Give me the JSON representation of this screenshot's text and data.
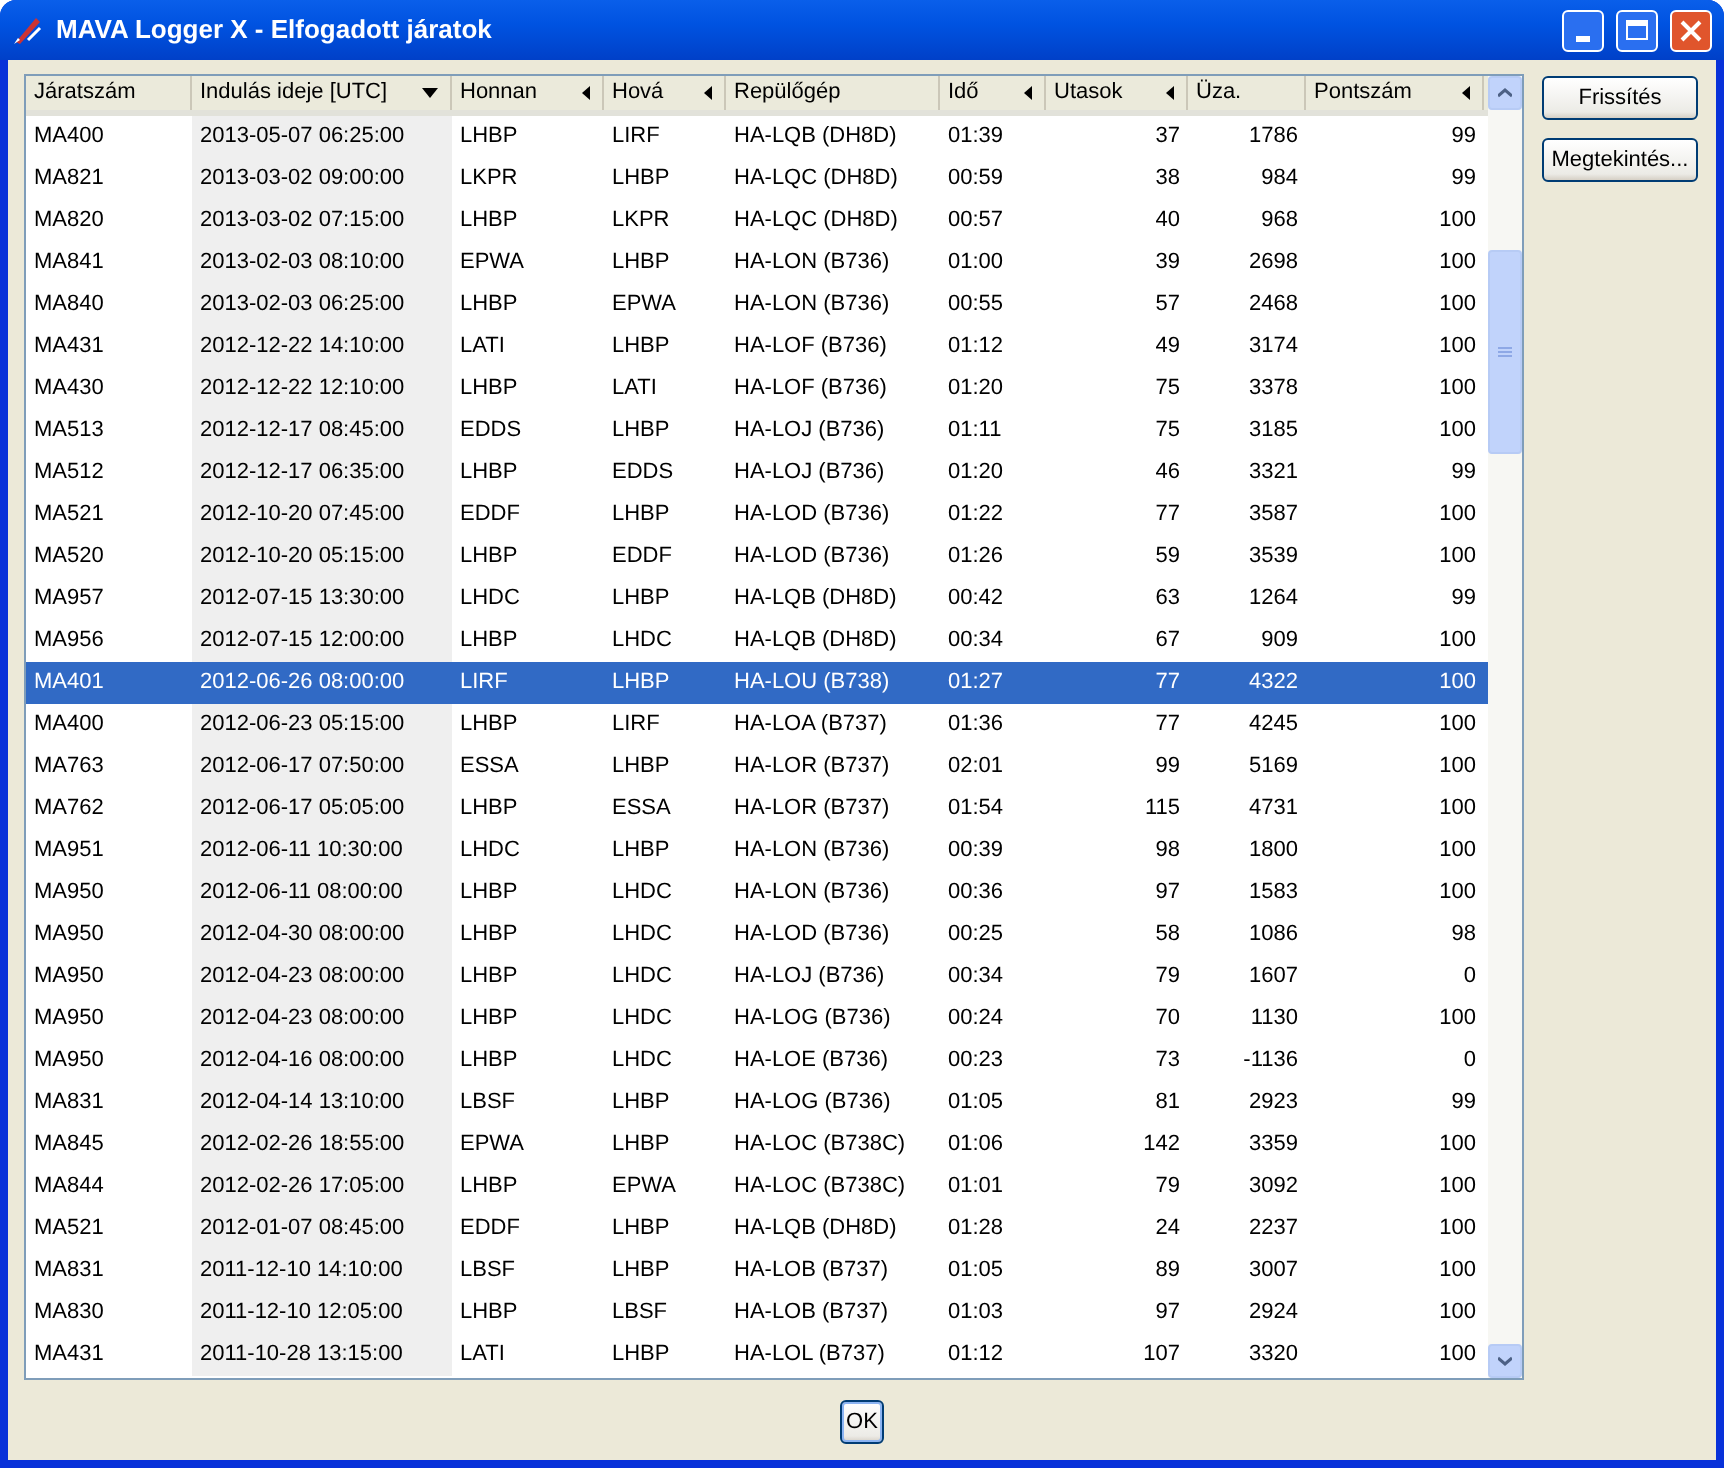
{
  "window": {
    "title": "MAVA Logger X - Elfogadott járatok"
  },
  "table": {
    "columns": [
      {
        "label": "Járatszám",
        "kind": "text",
        "sorted": false,
        "filter_arrow": false
      },
      {
        "label": "Indulás ideje [UTC]",
        "kind": "text",
        "sorted": true,
        "filter_arrow": false
      },
      {
        "label": "Honnan",
        "kind": "text",
        "sorted": false,
        "filter_arrow": true
      },
      {
        "label": "Hová",
        "kind": "text",
        "sorted": false,
        "filter_arrow": true
      },
      {
        "label": "Repülőgép",
        "kind": "text",
        "sorted": false,
        "filter_arrow": false
      },
      {
        "label": "Idő",
        "kind": "text",
        "sorted": false,
        "filter_arrow": true
      },
      {
        "label": "Utasok",
        "kind": "number",
        "sorted": false,
        "filter_arrow": true
      },
      {
        "label": "Üza.",
        "kind": "number",
        "sorted": false,
        "filter_arrow": false
      },
      {
        "label": "Pontszám",
        "kind": "number",
        "sorted": false,
        "filter_arrow": true
      }
    ],
    "rows": [
      {
        "cells": [
          "MA400",
          "2013-05-07 06:25:00",
          "LHBP",
          "LIRF",
          "HA-LQB (DH8D)",
          "01:39",
          "37",
          "1786",
          "99"
        ],
        "selected": false
      },
      {
        "cells": [
          "MA821",
          "2013-03-02 09:00:00",
          "LKPR",
          "LHBP",
          "HA-LQC (DH8D)",
          "00:59",
          "38",
          "984",
          "99"
        ],
        "selected": false
      },
      {
        "cells": [
          "MA820",
          "2013-03-02 07:15:00",
          "LHBP",
          "LKPR",
          "HA-LQC (DH8D)",
          "00:57",
          "40",
          "968",
          "100"
        ],
        "selected": false
      },
      {
        "cells": [
          "MA841",
          "2013-02-03 08:10:00",
          "EPWA",
          "LHBP",
          "HA-LON (B736)",
          "01:00",
          "39",
          "2698",
          "100"
        ],
        "selected": false
      },
      {
        "cells": [
          "MA840",
          "2013-02-03 06:25:00",
          "LHBP",
          "EPWA",
          "HA-LON (B736)",
          "00:55",
          "57",
          "2468",
          "100"
        ],
        "selected": false
      },
      {
        "cells": [
          "MA431",
          "2012-12-22 14:10:00",
          "LATI",
          "LHBP",
          "HA-LOF (B736)",
          "01:12",
          "49",
          "3174",
          "100"
        ],
        "selected": false
      },
      {
        "cells": [
          "MA430",
          "2012-12-22 12:10:00",
          "LHBP",
          "LATI",
          "HA-LOF (B736)",
          "01:20",
          "75",
          "3378",
          "100"
        ],
        "selected": false
      },
      {
        "cells": [
          "MA513",
          "2012-12-17 08:45:00",
          "EDDS",
          "LHBP",
          "HA-LOJ (B736)",
          "01:11",
          "75",
          "3185",
          "100"
        ],
        "selected": false
      },
      {
        "cells": [
          "MA512",
          "2012-12-17 06:35:00",
          "LHBP",
          "EDDS",
          "HA-LOJ (B736)",
          "01:20",
          "46",
          "3321",
          "99"
        ],
        "selected": false
      },
      {
        "cells": [
          "MA521",
          "2012-10-20 07:45:00",
          "EDDF",
          "LHBP",
          "HA-LOD (B736)",
          "01:22",
          "77",
          "3587",
          "100"
        ],
        "selected": false
      },
      {
        "cells": [
          "MA520",
          "2012-10-20 05:15:00",
          "LHBP",
          "EDDF",
          "HA-LOD (B736)",
          "01:26",
          "59",
          "3539",
          "100"
        ],
        "selected": false
      },
      {
        "cells": [
          "MA957",
          "2012-07-15 13:30:00",
          "LHDC",
          "LHBP",
          "HA-LQB (DH8D)",
          "00:42",
          "63",
          "1264",
          "99"
        ],
        "selected": false
      },
      {
        "cells": [
          "MA956",
          "2012-07-15 12:00:00",
          "LHBP",
          "LHDC",
          "HA-LQB (DH8D)",
          "00:34",
          "67",
          "909",
          "100"
        ],
        "selected": false
      },
      {
        "cells": [
          "MA401",
          "2012-06-26 08:00:00",
          "LIRF",
          "LHBP",
          "HA-LOU (B738)",
          "01:27",
          "77",
          "4322",
          "100"
        ],
        "selected": true
      },
      {
        "cells": [
          "MA400",
          "2012-06-23 05:15:00",
          "LHBP",
          "LIRF",
          "HA-LOA (B737)",
          "01:36",
          "77",
          "4245",
          "100"
        ],
        "selected": false
      },
      {
        "cells": [
          "MA763",
          "2012-06-17 07:50:00",
          "ESSA",
          "LHBP",
          "HA-LOR (B737)",
          "02:01",
          "99",
          "5169",
          "100"
        ],
        "selected": false
      },
      {
        "cells": [
          "MA762",
          "2012-06-17 05:05:00",
          "LHBP",
          "ESSA",
          "HA-LOR (B737)",
          "01:54",
          "115",
          "4731",
          "100"
        ],
        "selected": false
      },
      {
        "cells": [
          "MA951",
          "2012-06-11 10:30:00",
          "LHDC",
          "LHBP",
          "HA-LON (B736)",
          "00:39",
          "98",
          "1800",
          "100"
        ],
        "selected": false
      },
      {
        "cells": [
          "MA950",
          "2012-06-11 08:00:00",
          "LHBP",
          "LHDC",
          "HA-LON (B736)",
          "00:36",
          "97",
          "1583",
          "100"
        ],
        "selected": false
      },
      {
        "cells": [
          "MA950",
          "2012-04-30 08:00:00",
          "LHBP",
          "LHDC",
          "HA-LOD (B736)",
          "00:25",
          "58",
          "1086",
          "98"
        ],
        "selected": false
      },
      {
        "cells": [
          "MA950",
          "2012-04-23 08:00:00",
          "LHBP",
          "LHDC",
          "HA-LOJ (B736)",
          "00:34",
          "79",
          "1607",
          "0"
        ],
        "selected": false
      },
      {
        "cells": [
          "MA950",
          "2012-04-23 08:00:00",
          "LHBP",
          "LHDC",
          "HA-LOG (B736)",
          "00:24",
          "70",
          "1130",
          "100"
        ],
        "selected": false
      },
      {
        "cells": [
          "MA950",
          "2012-04-16 08:00:00",
          "LHBP",
          "LHDC",
          "HA-LOE (B736)",
          "00:23",
          "73",
          "-1136",
          "0"
        ],
        "selected": false
      },
      {
        "cells": [
          "MA831",
          "2012-04-14 13:10:00",
          "LBSF",
          "LHBP",
          "HA-LOG (B736)",
          "01:05",
          "81",
          "2923",
          "99"
        ],
        "selected": false
      },
      {
        "cells": [
          "MA845",
          "2012-02-26 18:55:00",
          "EPWA",
          "LHBP",
          "HA-LOC (B738C)",
          "01:06",
          "142",
          "3359",
          "100"
        ],
        "selected": false
      },
      {
        "cells": [
          "MA844",
          "2012-02-26 17:05:00",
          "LHBP",
          "EPWA",
          "HA-LOC (B738C)",
          "01:01",
          "79",
          "3092",
          "100"
        ],
        "selected": false
      },
      {
        "cells": [
          "MA521",
          "2012-01-07 08:45:00",
          "EDDF",
          "LHBP",
          "HA-LQB (DH8D)",
          "01:28",
          "24",
          "2237",
          "100"
        ],
        "selected": false
      },
      {
        "cells": [
          "MA831",
          "2011-12-10 14:10:00",
          "LBSF",
          "LHBP",
          "HA-LOB (B737)",
          "01:05",
          "89",
          "3007",
          "100"
        ],
        "selected": false
      },
      {
        "cells": [
          "MA830",
          "2011-12-10 12:05:00",
          "LHBP",
          "LBSF",
          "HA-LOB (B737)",
          "01:03",
          "97",
          "2924",
          "100"
        ],
        "selected": false
      },
      {
        "cells": [
          "MA431",
          "2011-10-28 13:15:00",
          "LATI",
          "LHBP",
          "HA-LOL (B737)",
          "01:12",
          "107",
          "3320",
          "100"
        ],
        "selected": false
      }
    ]
  },
  "side_buttons": [
    "Frissítés",
    "Megtekintés..."
  ],
  "ok_button": "OK"
}
